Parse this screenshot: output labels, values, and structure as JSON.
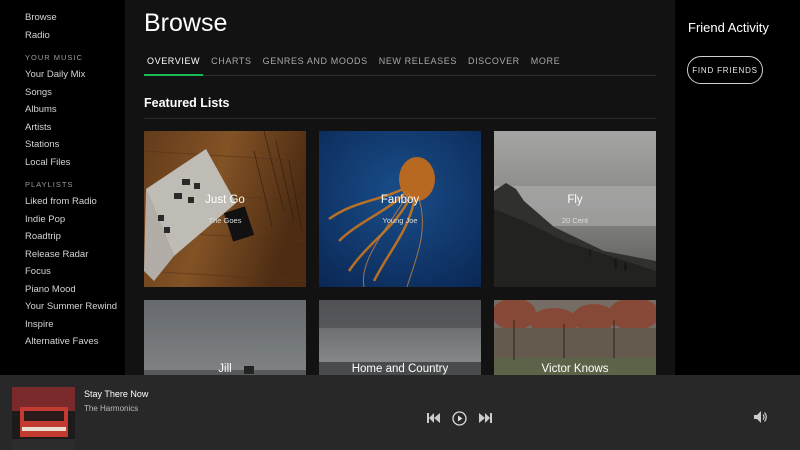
{
  "sidebar": {
    "top": [
      "Browse",
      "Radio"
    ],
    "your_music_label": "YOUR MUSIC",
    "your_music": [
      "Your Daily Mix",
      "Songs",
      "Albums",
      "Artists",
      "Stations",
      "Local Files"
    ],
    "playlists_label": "PLAYLISTS",
    "playlists": [
      "Liked from Radio",
      "Indie Pop",
      "Roadtrip",
      "Release Radar",
      "Focus",
      "Piano Mood",
      "Your Summer Rewind",
      "Inspire",
      "Alternative Faves"
    ]
  },
  "main": {
    "title": "Browse",
    "tabs": [
      "OVERVIEW",
      "CHARTS",
      "GENRES AND MOODS",
      "NEW RELEASES",
      "DISCOVER",
      "MORE"
    ],
    "active_tab": "OVERVIEW",
    "section_title": "Featured Lists",
    "cards": [
      {
        "name": "Just Go",
        "subtitle": "The Goes"
      },
      {
        "name": "Fanboy",
        "subtitle": "Young Joe"
      },
      {
        "name": "Fly",
        "subtitle": "20 Cent"
      },
      {
        "name": "Jill",
        "subtitle": ""
      },
      {
        "name": "Home and Country",
        "subtitle": ""
      },
      {
        "name": "Victor Knows",
        "subtitle": ""
      }
    ]
  },
  "right_panel": {
    "title": "Friend Activity",
    "find_button": "FIND FRIENDS"
  },
  "player": {
    "track": "Stay There Now",
    "artist": "The Harmonics"
  },
  "colors": {
    "accent": "#1db954",
    "main_bg": "#121212",
    "player_bg": "#282828"
  }
}
